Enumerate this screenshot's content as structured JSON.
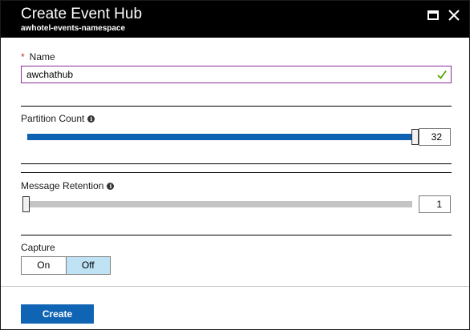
{
  "header": {
    "title": "Create Event Hub",
    "subtitle": "awhotel-events-namespace",
    "maximize_icon": "maximize-icon",
    "close_icon": "close-icon"
  },
  "name_field": {
    "required_marker": "*",
    "label": "Name",
    "value": "awchathub",
    "valid_icon": "checkmark-icon",
    "valid_color": "#57a300"
  },
  "partition_count": {
    "label": "Partition Count",
    "info_icon": "info-icon",
    "value": "32",
    "slider_fraction": 1.0
  },
  "message_retention": {
    "label": "Message Retention",
    "info_icon": "info-icon",
    "value": "1",
    "slider_fraction": 0.0
  },
  "capture": {
    "label": "Capture",
    "options": [
      "On",
      "Off"
    ],
    "selected": "Off"
  },
  "footer": {
    "create_label": "Create"
  },
  "colors": {
    "header_bg": "#000000",
    "accent": "#0f64b4",
    "name_border": "#8a2c9b",
    "toggle_selected": "#bfe3f5"
  }
}
